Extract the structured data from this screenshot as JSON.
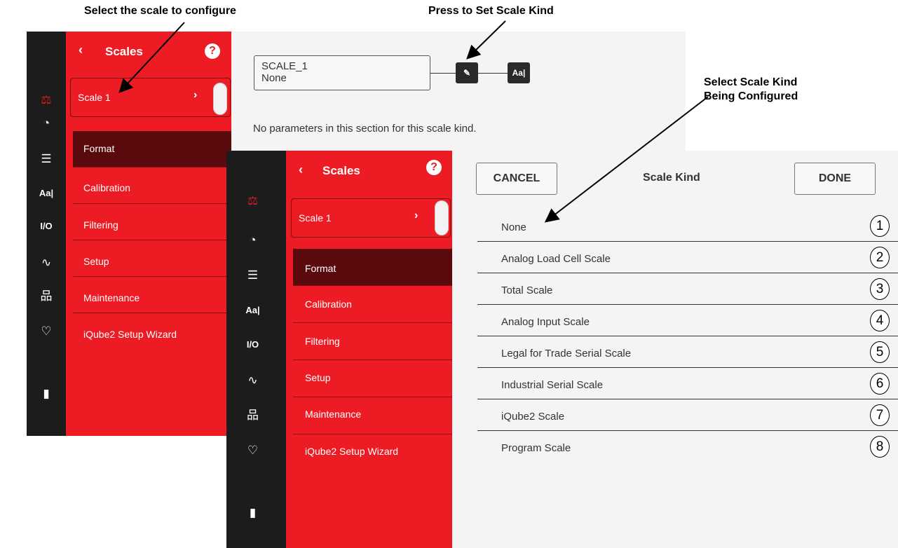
{
  "callouts": {
    "select_scale": "Select the scale to configure",
    "press_set_kind": "Press to Set Scale Kind",
    "select_kind_line1": "Select Scale Kind",
    "select_kind_line2": "Being Configured"
  },
  "sidebar_icons": [
    "scale-icon",
    "wifi-icon",
    "list-icon",
    "font-icon",
    "io-icon",
    "signal-icon",
    "network-icon",
    "heart-icon",
    "export-icon"
  ],
  "sidebar_io_label": "I/O",
  "sidebar_font_label": "Aa|",
  "menu": {
    "title": "Scales",
    "back": "‹",
    "help": "?",
    "scale_selector": "Scale 1",
    "items": [
      "Format",
      "Calibration",
      "Filtering",
      "Setup",
      "Maintenance",
      "iQube2 Setup Wizard"
    ]
  },
  "top_content": {
    "scale_name": "SCALE_1",
    "scale_kind": "None",
    "edit_btn_icon": "pencil-icon",
    "font_btn": "Aa|",
    "info": "No parameters in this section for this scale kind."
  },
  "scale_kind_dialog": {
    "cancel": "CANCEL",
    "title": "Scale Kind",
    "done": "DONE",
    "options": [
      {
        "label": "None",
        "num": "1"
      },
      {
        "label": "Analog Load Cell Scale",
        "num": "2"
      },
      {
        "label": "Total Scale",
        "num": "3"
      },
      {
        "label": "Analog Input Scale",
        "num": "4"
      },
      {
        "label": "Legal for Trade Serial Scale",
        "num": "5"
      },
      {
        "label": "Industrial Serial Scale",
        "num": "6"
      },
      {
        "label": "iQube2 Scale",
        "num": "7"
      },
      {
        "label": "Program Scale",
        "num": "8"
      }
    ]
  },
  "colors": {
    "red": "#ed1c24",
    "dark": "#1c1c1c",
    "active_item": "#5a0a0d"
  }
}
